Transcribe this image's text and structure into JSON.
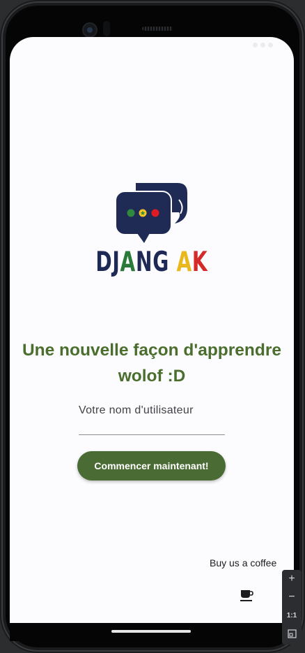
{
  "app": {
    "brand_name": "DJANG AK",
    "tagline": "Une nouvelle façon d'apprendre wolof :D",
    "accent_color": "#4a6b34",
    "tagline_color": "#4a6e2d"
  },
  "status_bar": {
    "time": ""
  },
  "form": {
    "username_label": "Votre nom d'utilisateur",
    "username_value": ""
  },
  "actions": {
    "start_label": "Commencer maintenant!",
    "coffee_label": "Buy us a coffee",
    "coffee_icon": "coffee-cup-icon"
  },
  "emulator_controls": {
    "zoom_in": "+",
    "zoom_out": "−",
    "actual_size": "1:1",
    "fit_icon": "fit-screen-icon"
  }
}
